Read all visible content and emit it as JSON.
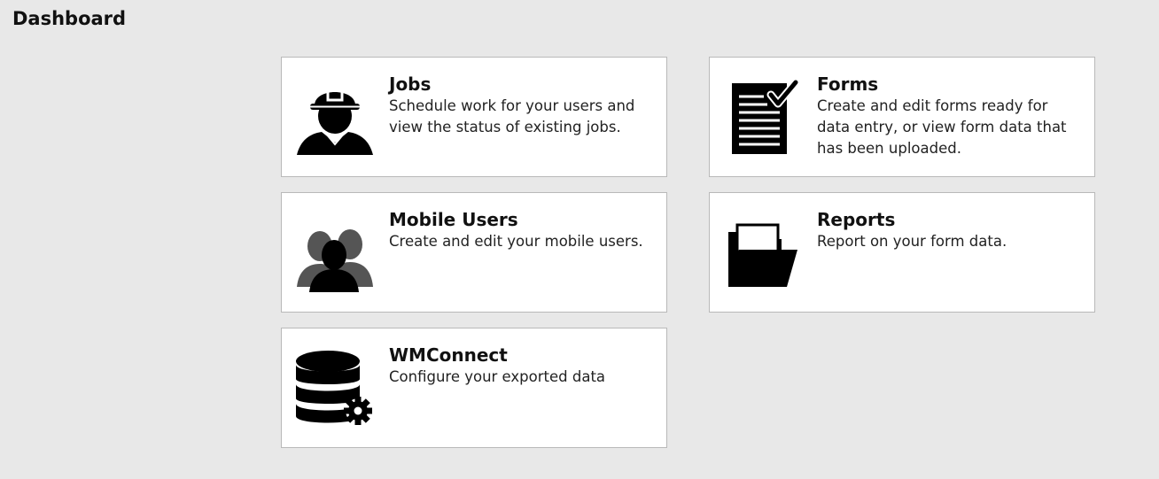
{
  "header": {
    "title": "Dashboard"
  },
  "tiles": [
    {
      "title": "Jobs",
      "description": "Schedule work for your users and view the status of existing jobs.",
      "icon": "construction-worker-icon"
    },
    {
      "title": "Forms",
      "description": "Create and edit forms ready for data entry, or view form data that has been uploaded.",
      "icon": "checklist-document-icon"
    },
    {
      "title": "Mobile Users",
      "description": "Create and edit your mobile users.",
      "icon": "users-group-icon"
    },
    {
      "title": "Reports",
      "description": "Report on your form data.",
      "icon": "folder-icon"
    },
    {
      "title": "WMConnect",
      "description": "Configure your exported data",
      "icon": "database-gear-icon"
    }
  ],
  "colors": {
    "background": "#e8e8e8",
    "tile_background": "#ffffff",
    "tile_border": "#b9b9b9",
    "icon": "#000000"
  }
}
